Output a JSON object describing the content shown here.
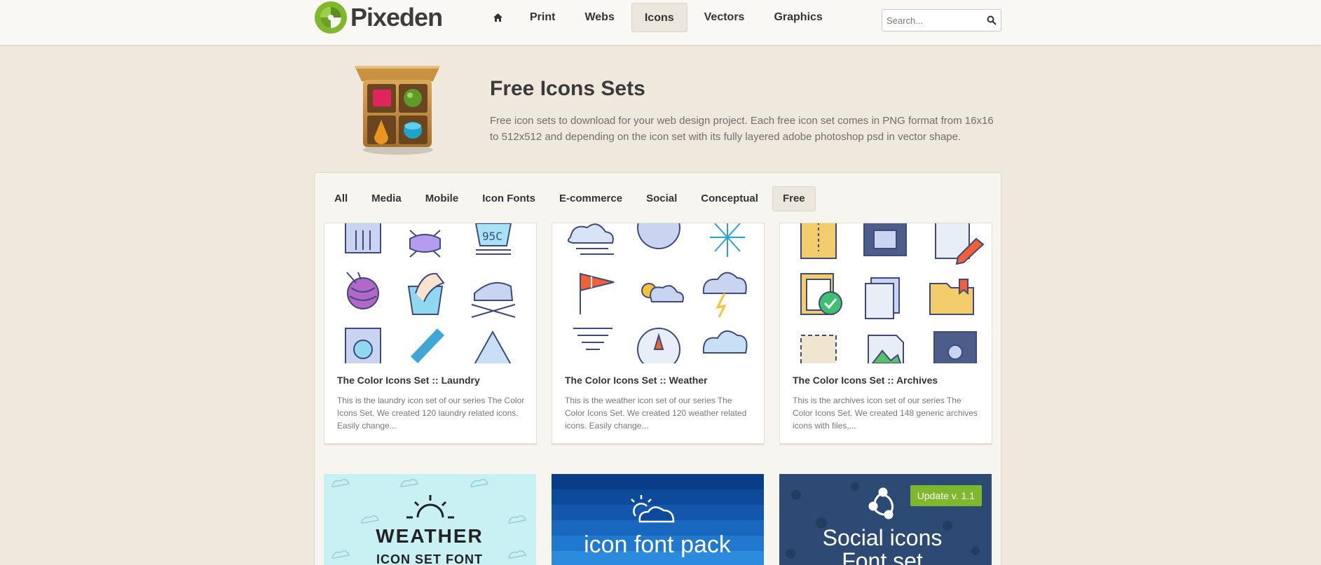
{
  "brand": {
    "name": "Pixeden"
  },
  "nav": {
    "home_icon": "home-icon",
    "items": [
      {
        "label": "Print"
      },
      {
        "label": "Webs"
      },
      {
        "label": "Icons"
      },
      {
        "label": "Vectors"
      },
      {
        "label": "Graphics"
      }
    ],
    "active": "Icons"
  },
  "search": {
    "placeholder": "Search...",
    "icon": "search-icon"
  },
  "hero": {
    "title": "Free Icons Sets",
    "description": "Free icon sets to download for your web design project. Each free icon set comes in PNG format from 16x16 to 512x512 and depending on the icon set with its fully layered adobe photoshop psd in vector shape."
  },
  "filters": {
    "items": [
      "All",
      "Media",
      "Mobile",
      "Icon Fonts",
      "E-commerce",
      "Social",
      "Conceptual",
      "Free"
    ],
    "active": "Free"
  },
  "cards": [
    {
      "title": "The Color Icons Set :: Laundry",
      "description": "This is the laundry icon set of our series The Color Icons Set. We created 120 laundry related icons. Easily change...",
      "thumb_text": "95C"
    },
    {
      "title": "The Color Icons Set :: Weather",
      "description": "This is the weather icon set of our series The Color Icons Set. We created 120 weather related icons. Easily change..."
    },
    {
      "title": "The Color Icons Set :: Archives",
      "description": "This is the archives icon set of our series The Color Icons Set. We created 148 generic archives icons with files,..."
    }
  ],
  "promos": [
    {
      "line1": "WEATHER",
      "line2": "ICON SET FONT"
    },
    {
      "line1": "icon font pack"
    },
    {
      "line1": "Social icons",
      "line2": "Font set",
      "badge": "Update v. 1.1"
    }
  ],
  "colors": {
    "background": "#efe8dc",
    "accent_green": "#7fb82c",
    "promo_weather_bg": "#c9f0f3",
    "promo_iconfont_bg": "#0e4a9a",
    "promo_social_bg": "#2c4a73"
  }
}
